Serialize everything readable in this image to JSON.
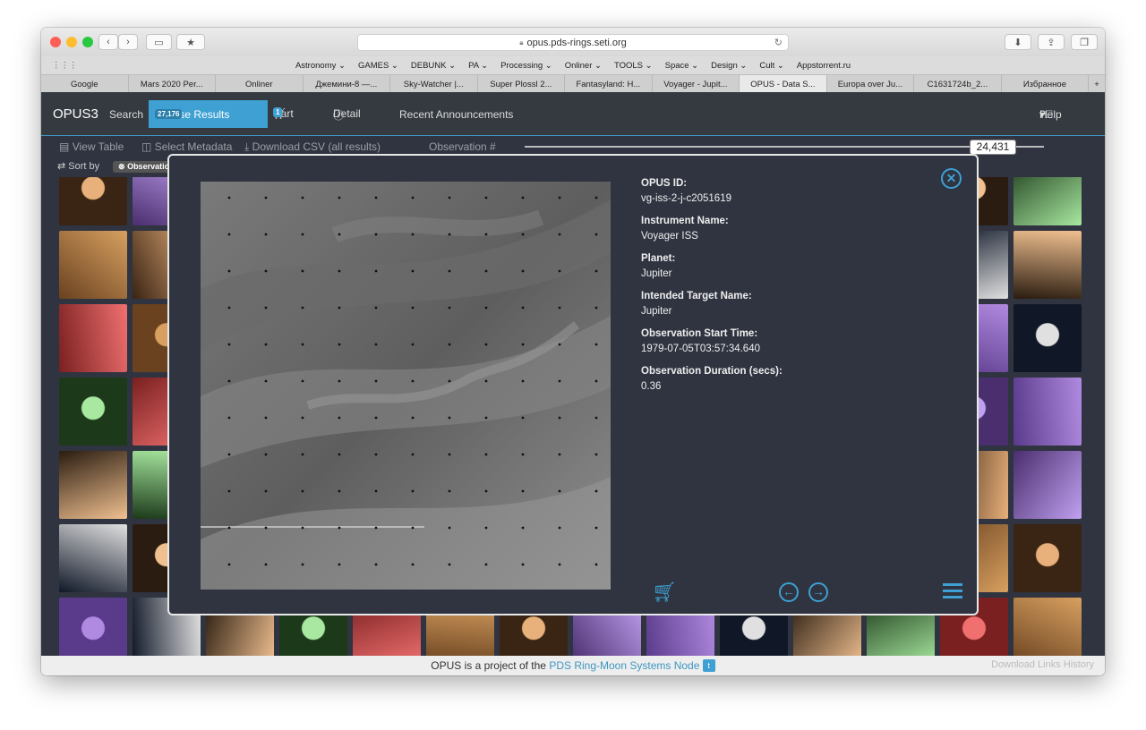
{
  "browser": {
    "url": "opus.pds-rings.seti.org",
    "favorites": [
      "Astronomy ⌄",
      "GAMES ⌄",
      "DEBUNK ⌄",
      "PA ⌄",
      "Processing ⌄",
      "Onliner ⌄",
      "TOOLS ⌄",
      "Space ⌄",
      "Design ⌄",
      "Cult ⌄",
      "Appstorrent.ru"
    ],
    "tabs": [
      "Google",
      "Mars 2020 Per...",
      "Onliner",
      "Джемини-8 —...",
      "Sky-Watcher |...",
      "Super Plossl 2...",
      "Fantasyland: H...",
      "Voyager - Jupit...",
      "OPUS - Data S...",
      "Europa over Ju...",
      "C1631724b_2...",
      "Избранное"
    ],
    "active_tab": 8
  },
  "nav": {
    "brand": "OPUS3",
    "search": "Search",
    "browse": "Browse Results",
    "browse_count": "27,176",
    "cart": "Cart",
    "cart_count": "1",
    "detail": "Detail",
    "announcements": "Recent Announcements",
    "help": "Help"
  },
  "toolbar": {
    "view_table": "View Table",
    "select_metadata": "Select Metadata",
    "download_csv": "Download CSV (all results)",
    "observation_label": "Observation #",
    "observation_value": "24,431",
    "observation_progress": 0.88,
    "sort_by": "Sort by",
    "sort_chip": "Observation"
  },
  "modal": {
    "fields": [
      {
        "label": "OPUS ID:",
        "value": "vg-iss-2-j-c2051619"
      },
      {
        "label": "Instrument Name:",
        "value": "Voyager ISS"
      },
      {
        "label": "Planet:",
        "value": "Jupiter"
      },
      {
        "label": "Intended Target Name:",
        "value": "Jupiter"
      },
      {
        "label": "Observation Start Time:",
        "value": "1979-07-05T03:57:34.640"
      },
      {
        "label": "Observation Duration (secs):",
        "value": "0.36"
      }
    ]
  },
  "footer": {
    "text": "OPUS is a project of the",
    "link": "PDS Ring-Moon Systems Node",
    "download_history": "Download Links History"
  },
  "colors": {
    "accent": "#3ea0d3",
    "bg": "#2f3440",
    "nav": "#343a40"
  }
}
